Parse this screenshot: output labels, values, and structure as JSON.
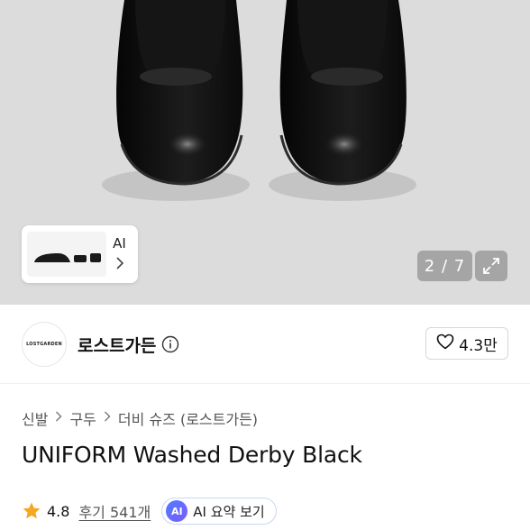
{
  "gallery": {
    "ai_thumb_label": "AI",
    "counter": "2 / 7"
  },
  "shop": {
    "logo_text": "LOSTGARDEN",
    "name": "로스트가든",
    "rating": "4.3만"
  },
  "breadcrumb": [
    "신발",
    "구두",
    "더비 슈즈 (로스트가든)"
  ],
  "product": {
    "title": "UNIFORM Washed Derby Black"
  },
  "reviews": {
    "score": "4.8",
    "link_text": "후기 541개",
    "ai_badge": "AI",
    "ai_summary_label": "AI 요약 보기"
  },
  "colors": {
    "star": "#f5a623",
    "ai_gradient_start": "#4f7cff",
    "ai_gradient_end": "#7b5cff",
    "hero_bg": "#dcdcdc"
  }
}
